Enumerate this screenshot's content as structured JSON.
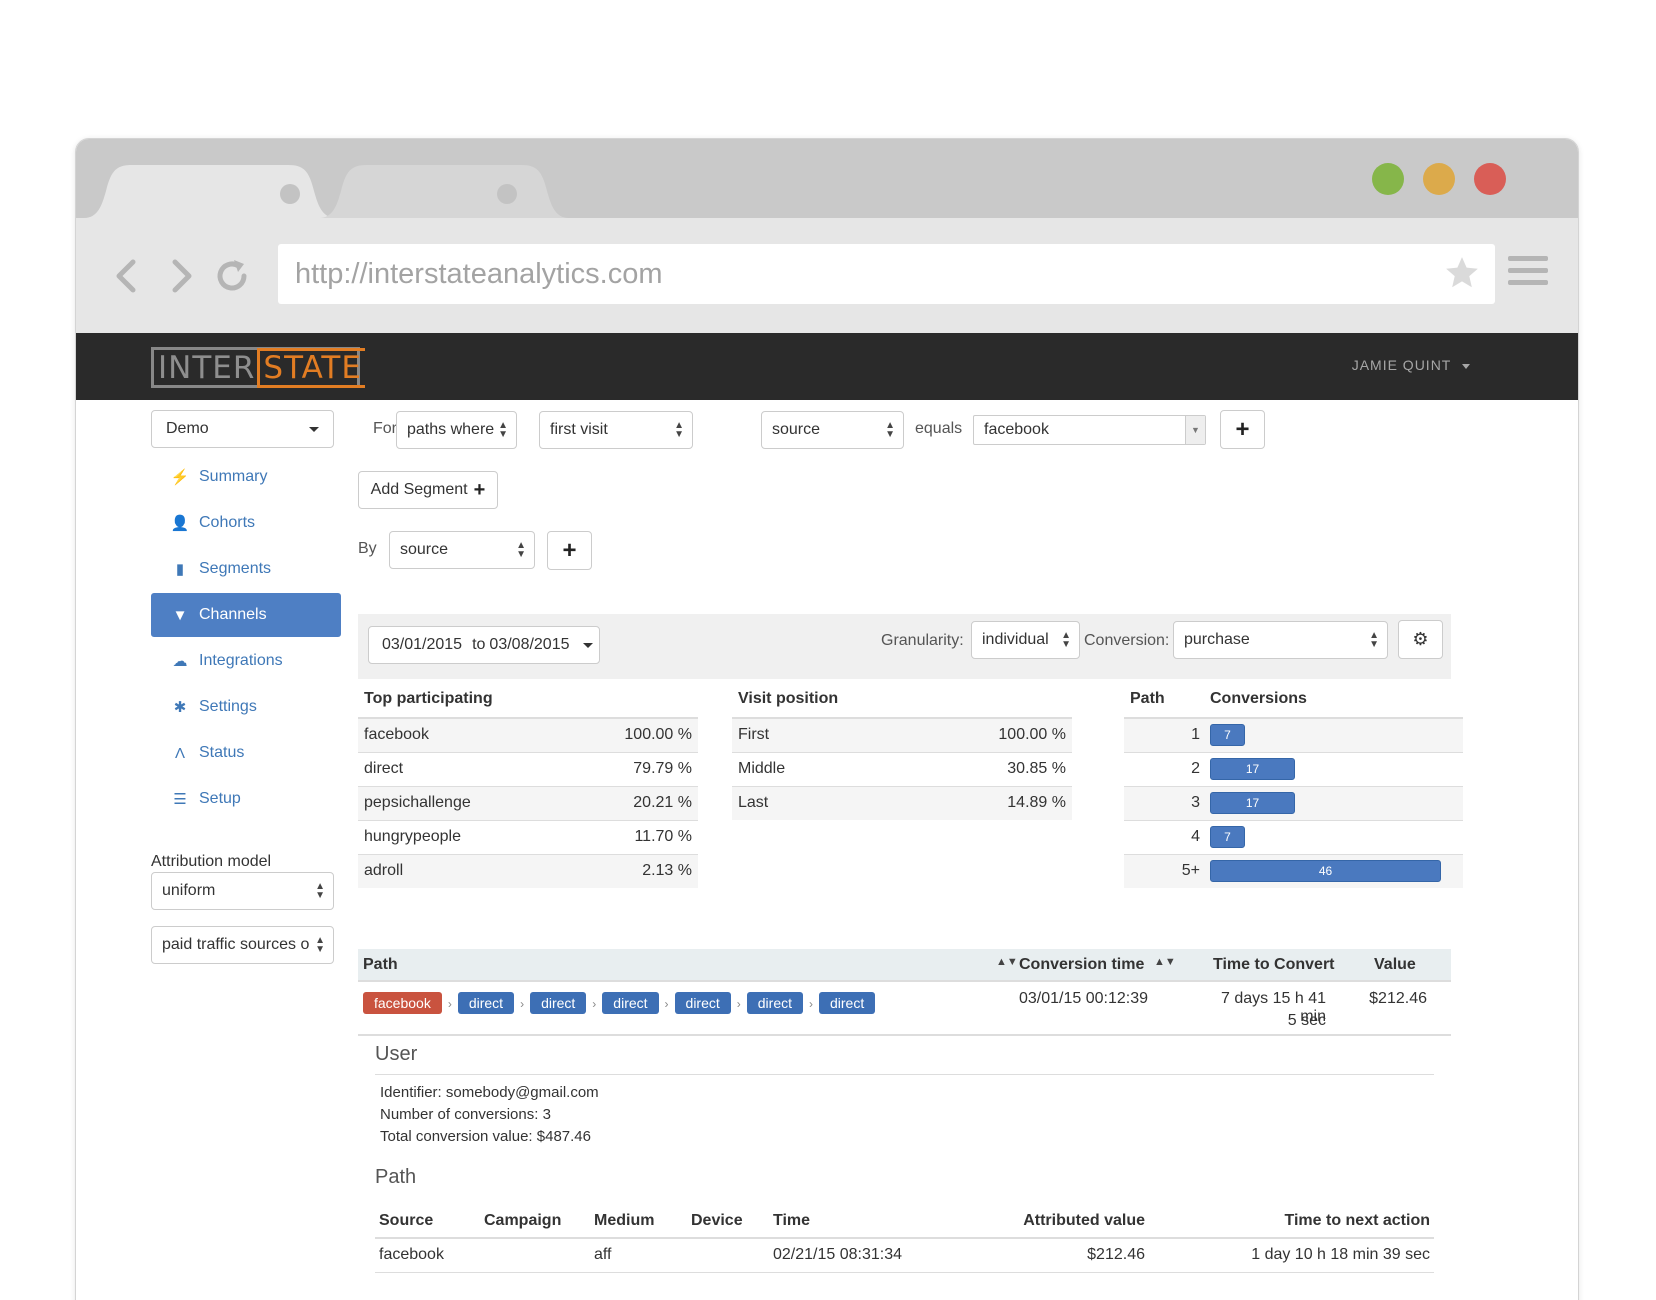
{
  "browser": {
    "url": "http://interstateanalytics.com",
    "colors": {
      "close": "#d95e57",
      "minimize": "#dcaa4b",
      "maximize": "#86b64a"
    }
  },
  "navbar": {
    "logo_left": "INTER",
    "logo_right": "STATE",
    "user": "JAMIE QUINT"
  },
  "sidebar": {
    "project": "Demo",
    "items": [
      {
        "label": "Summary",
        "icon": "bolt-icon",
        "glyph": "⚡"
      },
      {
        "label": "Cohorts",
        "icon": "user-icon",
        "glyph": "👤"
      },
      {
        "label": "Segments",
        "icon": "bar-chart-icon",
        "glyph": "▮"
      },
      {
        "label": "Channels",
        "icon": "filter-icon",
        "glyph": "▼"
      },
      {
        "label": "Integrations",
        "icon": "cloud-icon",
        "glyph": "☁"
      },
      {
        "label": "Settings",
        "icon": "asterisk-icon",
        "glyph": "✱"
      },
      {
        "label": "Status",
        "icon": "road-icon",
        "glyph": "Ʌ"
      },
      {
        "label": "Setup",
        "icon": "tasks-icon",
        "glyph": "☰"
      }
    ],
    "attribution_label": "Attribution model",
    "attribution_value": "uniform",
    "paid_traffic_value": "paid traffic sources or"
  },
  "filters": {
    "for_label": "For",
    "paths_where": "paths where",
    "visit": "first visit",
    "field": "source",
    "equals_label": "equals",
    "value": "facebook",
    "add_segment": "Add Segment",
    "by_label": "By",
    "by_value": "source"
  },
  "toolbar": {
    "date_from": "03/01/2015",
    "date_to_label": "to",
    "date_to": "03/08/2015",
    "granularity_label": "Granularity:",
    "granularity": "individual",
    "conversion_label": "Conversion:",
    "conversion": "purchase"
  },
  "top_participating": {
    "header": "Top participating",
    "rows": [
      {
        "name": "facebook",
        "value": "100.00 %"
      },
      {
        "name": "direct",
        "value": "79.79 %"
      },
      {
        "name": "pepsichallenge",
        "value": "20.21 %"
      },
      {
        "name": "hungrypeople",
        "value": "11.70 %"
      },
      {
        "name": "adroll",
        "value": "2.13 %"
      }
    ]
  },
  "visit_position": {
    "header": "Visit position",
    "rows": [
      {
        "name": "First",
        "value": "100.00 %"
      },
      {
        "name": "Middle",
        "value": "30.85 %"
      },
      {
        "name": "Last",
        "value": "14.89 %"
      }
    ]
  },
  "conversions": {
    "path_header": "Path",
    "conv_header": "Conversions",
    "rows": [
      {
        "path": "1",
        "value": 7,
        "label": "7"
      },
      {
        "path": "2",
        "value": 17,
        "label": "17"
      },
      {
        "path": "3",
        "value": 17,
        "label": "17"
      },
      {
        "path": "4",
        "value": 7,
        "label": "7"
      },
      {
        "path": "5+",
        "value": 46,
        "label": "46"
      }
    ]
  },
  "path_table": {
    "headers": {
      "path": "Path",
      "conversion_time": "Conversion time",
      "time_to_convert": "Time to Convert",
      "value": "Value"
    },
    "row": {
      "steps": [
        "facebook",
        "direct",
        "direct",
        "direct",
        "direct",
        "direct",
        "direct"
      ],
      "separator": "›",
      "conversion_time": "03/01/15 00:12:39",
      "time_to_convert_1": "7 days 15 h 41 min",
      "time_to_convert_2": "5 sec",
      "value": "$212.46"
    }
  },
  "user": {
    "title": "User",
    "identifier": "Identifier: somebody@gmail.com",
    "conversions": "Number of conversions: 3",
    "total": "Total conversion value: $487.46"
  },
  "user_path": {
    "title": "Path",
    "headers": [
      "Source",
      "Campaign",
      "Medium",
      "Device",
      "Time",
      "Attributed value",
      "Time to next action"
    ],
    "rows": [
      {
        "source": "facebook",
        "campaign": "",
        "medium": "aff",
        "device": "",
        "time": "02/21/15 08:31:34",
        "value": "$212.46",
        "next": "1 day 10 h 18 min 39 sec"
      }
    ]
  }
}
